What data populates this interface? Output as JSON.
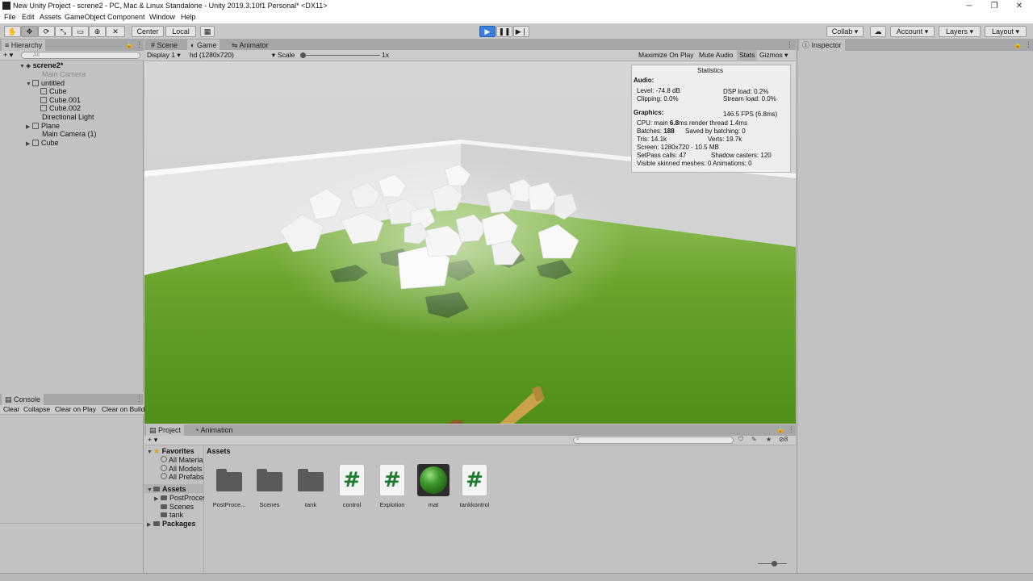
{
  "window": {
    "title": "New Unity Project - screne2 - PC, Mac & Linux Standalone - Unity 2019.3.10f1 Personal* <DX11>",
    "minimize": "─",
    "restore": "❐",
    "close": "✕"
  },
  "menu": [
    "File",
    "Edit",
    "Assets",
    "GameObject",
    "Component",
    "Window",
    "Help"
  ],
  "toolbar": {
    "pivot": "Center",
    "space": "Local",
    "collab": "Collab",
    "account": "Account",
    "layers": "Layers",
    "layout": "Layout"
  },
  "hierarchy": {
    "tab": "Hierarchy",
    "search_placeholder": "All",
    "scene": "screne2*",
    "items": [
      {
        "label": "Main Camera"
      },
      {
        "label": "untitled"
      },
      {
        "label": "Cube"
      },
      {
        "label": "Cube.001"
      },
      {
        "label": "Cube.002"
      },
      {
        "label": "Directional Light"
      },
      {
        "label": "Plane"
      },
      {
        "label": "Main Camera (1)"
      },
      {
        "label": "Cube"
      }
    ]
  },
  "view_tabs": [
    "Scene",
    "Game",
    "Animator"
  ],
  "game_bar": {
    "display": "Display 1",
    "resolution": "hd (1280x720)",
    "scale_label": "Scale",
    "scale_value": "1x",
    "maximize": "Maximize On Play",
    "mute": "Mute Audio",
    "stats": "Stats",
    "gizmos": "Gizmos"
  },
  "stats": {
    "title": "Statistics",
    "audio_header": "Audio:",
    "level": "Level: -74.8 dB",
    "clipping": "Clipping: 0.0%",
    "dsp": "DSP load: 0.2%",
    "stream": "Stream load: 0.0%",
    "graphics_header": "Graphics:",
    "fps": "146.5 FPS (6.8ms)",
    "cpu_prefix": "CPU: main ",
    "cpu_main": "6.8",
    "cpu_suffix": "ms  render thread 1.4ms",
    "batches_prefix": "Batches: ",
    "batches": "188",
    "saved": "Saved by batching: 0",
    "tris": "Tris: 14.1k",
    "verts": "Verts: 19.7k",
    "screen": "Screen: 1280x720 - 10.5 MB",
    "setpass": "SetPass calls: 47",
    "shadow": "Shadow casters: 120",
    "skinned": "Visible skinned meshes: 0  Animations: 0"
  },
  "inspector": {
    "tab": "Inspector"
  },
  "console": {
    "tab": "Console",
    "buttons": [
      "Clear",
      "Collapse",
      "Clear on Play",
      "Clear on Build"
    ]
  },
  "project": {
    "tabs": [
      "Project",
      "Animation"
    ],
    "add": "+",
    "favorites": "Favorites",
    "fav_items": [
      "All Materia",
      "All Models",
      "All Prefabs"
    ],
    "assets_root": "Assets",
    "asset_folders": [
      "PostProces",
      "Scenes",
      "tank"
    ],
    "packages": "Packages",
    "breadcrumb": "Assets",
    "hidden_count": "8",
    "assets": [
      {
        "label": "PostProce...",
        "kind": "folder"
      },
      {
        "label": "Scenes",
        "kind": "folder"
      },
      {
        "label": "tank",
        "kind": "folder"
      },
      {
        "label": "control",
        "kind": "script"
      },
      {
        "label": "Explotion",
        "kind": "script"
      },
      {
        "label": "mat",
        "kind": "material"
      },
      {
        "label": "tankkontrol",
        "kind": "script"
      }
    ]
  },
  "colors": {
    "ground": "#5a9c1f",
    "play_active": "#3c7fd9",
    "script_hash": "#1e7a2e"
  }
}
